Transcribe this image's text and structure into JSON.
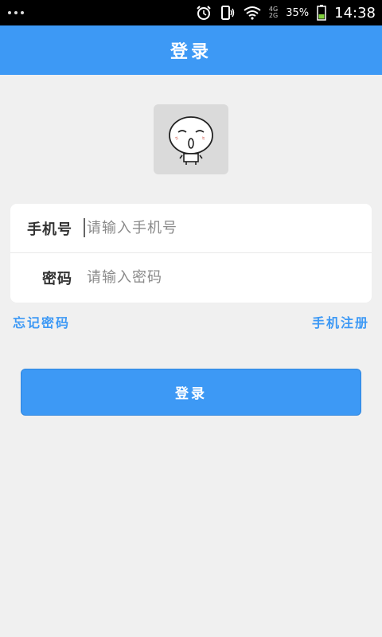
{
  "status_bar": {
    "icons": [
      "menu-dots-icon",
      "alarm-icon",
      "phone-signal-icon",
      "wifi-icon",
      "network-4g-2g-icon",
      "battery-icon"
    ],
    "network_top": "4G",
    "network_bottom": "2G",
    "battery": "35%",
    "time": "14:38"
  },
  "header": {
    "title": "登录"
  },
  "avatar": {
    "icon": "cartoon-avatar-icon"
  },
  "form": {
    "phone_label": "手机号",
    "phone_placeholder": "请输入手机号",
    "password_label": "密码",
    "password_placeholder": "请输入密码"
  },
  "links": {
    "forgot_password": "忘记密码",
    "register": "手机注册"
  },
  "login_button": "登录",
  "colors": {
    "primary": "#3d99f5",
    "background": "#f0f0f0",
    "card": "#ffffff"
  }
}
